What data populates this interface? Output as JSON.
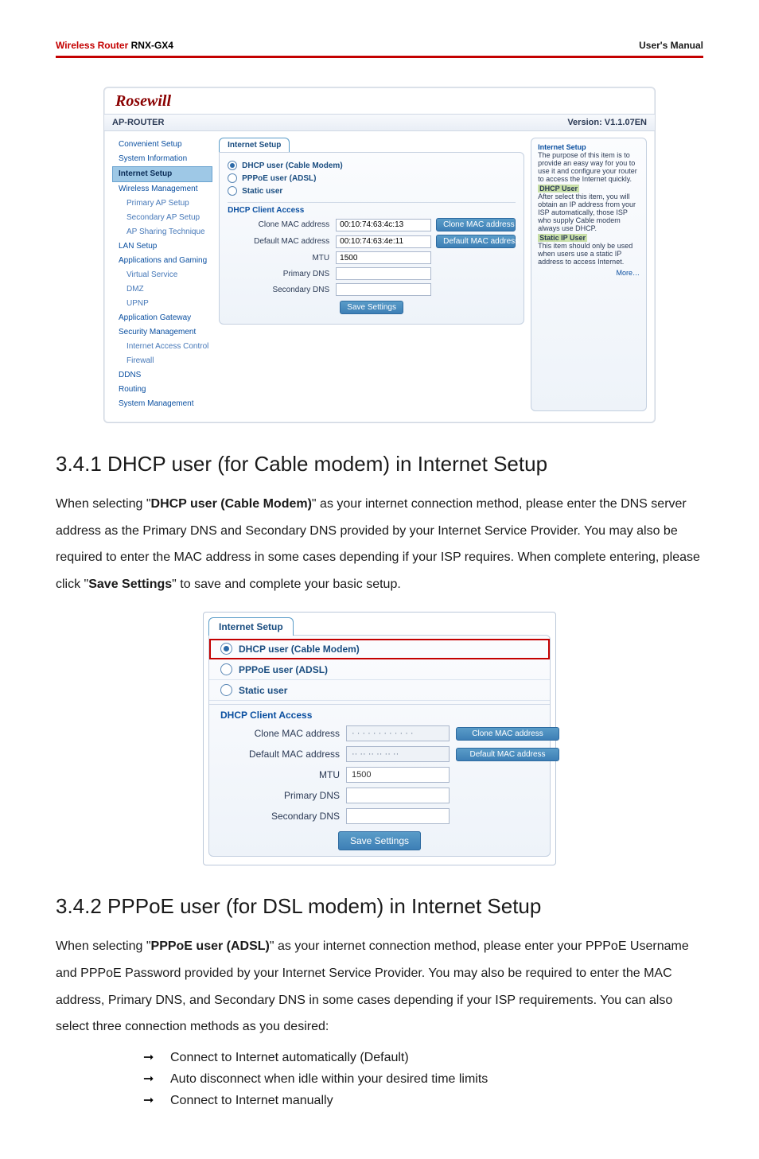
{
  "header": {
    "brand": "Wireless Router",
    "model": "RNX-GX4",
    "doc": "User's Manual"
  },
  "app": {
    "logo": "Rosewill",
    "title": "AP-ROUTER",
    "version": "Version: V1.1.07EN",
    "sidebar": [
      {
        "label": "Convenient Setup",
        "sel": false
      },
      {
        "label": "System Information",
        "sel": false
      },
      {
        "label": "Internet Setup",
        "sel": true
      },
      {
        "label": "Wireless Management",
        "sel": false
      },
      {
        "label": "Primary AP Setup",
        "sel": false,
        "small": true
      },
      {
        "label": "Secondary AP Setup",
        "sel": false,
        "small": true
      },
      {
        "label": "AP Sharing Technique",
        "sel": false,
        "small": true
      },
      {
        "label": "LAN Setup",
        "sel": false
      },
      {
        "label": "Applications and Gaming",
        "sel": false
      },
      {
        "label": "Virtual Service",
        "sel": false,
        "small": true
      },
      {
        "label": "DMZ",
        "sel": false,
        "small": true
      },
      {
        "label": "UPNP",
        "sel": false,
        "small": true
      },
      {
        "label": "Application Gateway",
        "sel": false
      },
      {
        "label": "Security Management",
        "sel": false
      },
      {
        "label": "Internet Access Control",
        "sel": false,
        "small": true
      },
      {
        "label": "Firewall",
        "sel": false,
        "small": true
      },
      {
        "label": "DDNS",
        "sel": false
      },
      {
        "label": "Routing",
        "sel": false
      },
      {
        "label": "System Management",
        "sel": false
      }
    ],
    "tab": "Internet Setup",
    "radios": {
      "dhcp": "DHCP user (Cable Modem)",
      "pppoe": "PPPoE user (ADSL)",
      "static": "Static user",
      "selected": "dhcp"
    },
    "section": "DHCP Client Access",
    "fields": {
      "clone_mac_label": "Clone MAC address",
      "clone_mac_value": "00:10:74:63:4c:13",
      "clone_mac_btn": "Clone MAC address",
      "default_mac_label": "Default MAC address",
      "default_mac_value": "00:10:74:63:4e:11",
      "default_mac_btn": "Default MAC address",
      "mtu_label": "MTU",
      "mtu_value": "1500",
      "primary_dns_label": "Primary DNS",
      "secondary_dns_label": "Secondary DNS"
    },
    "save_label": "Save Settings",
    "help": {
      "title": "Internet Setup",
      "intro": "The purpose of this item is to provide an easy way for you to use it and configure your router to access the Internet quickly.",
      "h1": "DHCP User",
      "p1": "After select this item, you will obtain an IP address from your ISP automatically, those ISP who supply Cable modem always use DHCP.",
      "h2": "Static IP User",
      "p2": "This item should only be used when users use a static IP address to access Internet.",
      "more": "More…"
    }
  },
  "section_341": {
    "heading": "3.4.1 DHCP user (for Cable modem) in Internet Setup",
    "para_a": "When selecting \"",
    "para_bold_a": "DHCP user (Cable Modem)",
    "para_b": "\" as your internet connection method, please enter the DNS server address as the Primary DNS and Secondary DNS provided by your Internet Service Provider. You may also be required to enter the MAC address in some cases depending if your ISP requires. When complete entering, please click \"",
    "para_bold_b": "Save Settings",
    "para_c": "\" to save and complete your basic setup."
  },
  "zoom": {
    "tab": "Internet Setup",
    "r_dhcp": "DHCP user (Cable Modem)",
    "r_pppoe": "PPPoE user (ADSL)",
    "r_static": "Static user",
    "section": "DHCP Client Access",
    "clone_mac_label": "Clone MAC address",
    "clone_mac_value": "· · · · · · · · · · · ·",
    "clone_mac_btn": "Clone MAC address",
    "default_mac_label": "Default MAC address",
    "default_mac_value": "·· ·· ·· ·· ·· ··",
    "default_mac_btn": "Default MAC address",
    "mtu_label": "MTU",
    "mtu_value": "1500",
    "primary_dns_label": "Primary DNS",
    "secondary_dns_label": "Secondary DNS",
    "save": "Save Settings"
  },
  "section_342": {
    "heading": "3.4.2 PPPoE user (for DSL modem) in Internet Setup",
    "para_a": "When selecting \"",
    "para_bold": "PPPoE user (ADSL)",
    "para_b": "\" as your internet connection method, please enter your PPPoE Username and PPPoE Password provided by your Internet Service Provider. You may also be required to enter the MAC address, Primary DNS, and Secondary DNS in some cases depending if your ISP requirements. You can also select three connection methods as you desired:",
    "bullets": [
      "Connect to Internet automatically (Default)",
      "Auto disconnect when idle within your desired time limits",
      "Connect to Internet manually"
    ]
  }
}
